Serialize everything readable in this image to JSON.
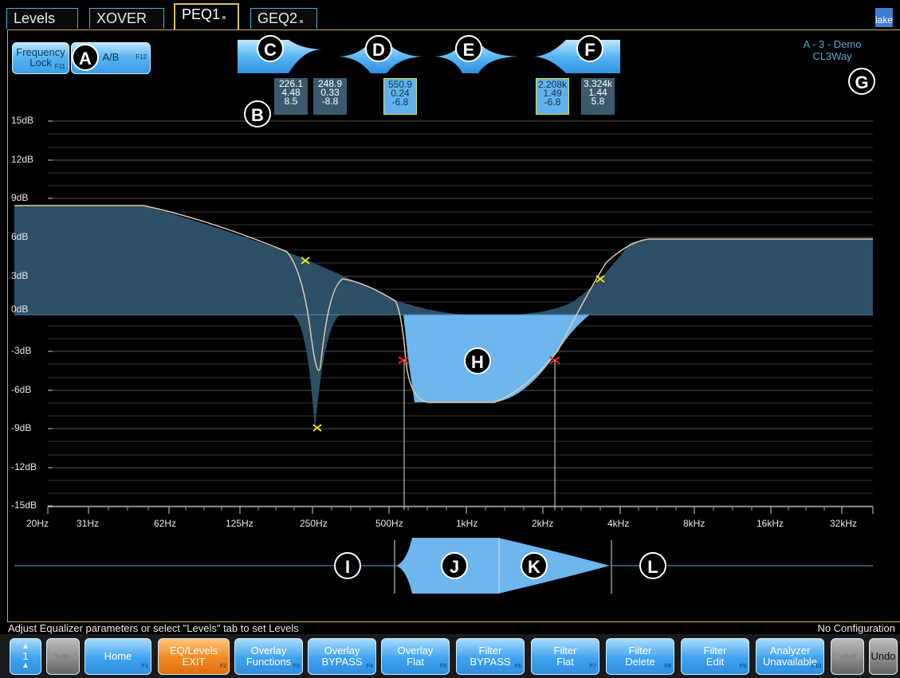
{
  "tabs": [
    {
      "label": "Levels"
    },
    {
      "label": "XOVER"
    },
    {
      "label": "PEQ1"
    },
    {
      "label": "GEQ2"
    }
  ],
  "brand": "lake",
  "top_buttons": {
    "freq_lock_line1": "Frequency",
    "freq_lock_line2": "Lock",
    "freq_lock_fkey": "F11",
    "ab_label": "A/B",
    "ab_fkey": "F12"
  },
  "device": {
    "line1": "A - 3 - Demo",
    "line2": "CL3Way"
  },
  "param_boxes": [
    {
      "freq": "226.1",
      "q": "4.48",
      "gain": "8.5",
      "selected": false
    },
    {
      "freq": "248.9",
      "q": "0.33",
      "gain": "-8.8",
      "selected": false
    },
    {
      "freq": "550.9",
      "q": "0.24",
      "gain": "-6.8",
      "selected": true
    },
    {
      "freq": "2.208k",
      "q": "1.49",
      "gain": "-6.8",
      "selected": true
    },
    {
      "freq": "3.324k",
      "q": "1.44",
      "gain": "5.8",
      "selected": false
    }
  ],
  "y_axis": [
    "15dB",
    "12dB",
    "9dB",
    "6dB",
    "3dB",
    "0dB",
    "-3dB",
    "-6dB",
    "-9dB",
    "-12dB",
    "-15dB"
  ],
  "x_axis": [
    "20Hz",
    "31Hz",
    "62Hz",
    "125Hz",
    "250Hz",
    "500Hz",
    "1kHz",
    "2kHz",
    "4kHz",
    "8kHz",
    "16kHz",
    "32kHz"
  ],
  "callouts": [
    "A",
    "B",
    "C",
    "D",
    "E",
    "F",
    "G",
    "H",
    "I",
    "J",
    "K",
    "L"
  ],
  "status_left": "Adjust Equalizer parameters or select \"Levels\" tab to set Levels",
  "status_right": "No Configuration",
  "bottom_buttons": [
    {
      "line1": "Home",
      "line2": "",
      "fkey": "F1"
    },
    {
      "line1": "EQ/Levels",
      "line2": "EXIT",
      "fkey": "F2"
    },
    {
      "line1": "Overlay",
      "line2": "Functions",
      "fkey": "F3"
    },
    {
      "line1": "Overlay",
      "line2": "BYPASS",
      "fkey": "F4"
    },
    {
      "line1": "Overlay",
      "line2": "Flat",
      "fkey": "F5"
    },
    {
      "line1": "Filter",
      "line2": "BYPASS",
      "fkey": "F6"
    },
    {
      "line1": "Filter",
      "line2": "Flat",
      "fkey": "F7"
    },
    {
      "line1": "Filter",
      "line2": "Delete",
      "fkey": "F8"
    },
    {
      "line1": "Filter",
      "line2": "Edit",
      "fkey": "F9"
    },
    {
      "line1": "Analyzer",
      "line2": "Unavailable",
      "fkey": "F10"
    }
  ],
  "page_number": "1",
  "undo_label": "Undo",
  "colors": {
    "accent": "#5aa8d8",
    "fill_dark": "#2c4f66",
    "fill_light": "#6db7ee",
    "marker_yellow": "#f0e020",
    "marker_red": "#e02020",
    "tab_gold": "#d8c060"
  }
}
